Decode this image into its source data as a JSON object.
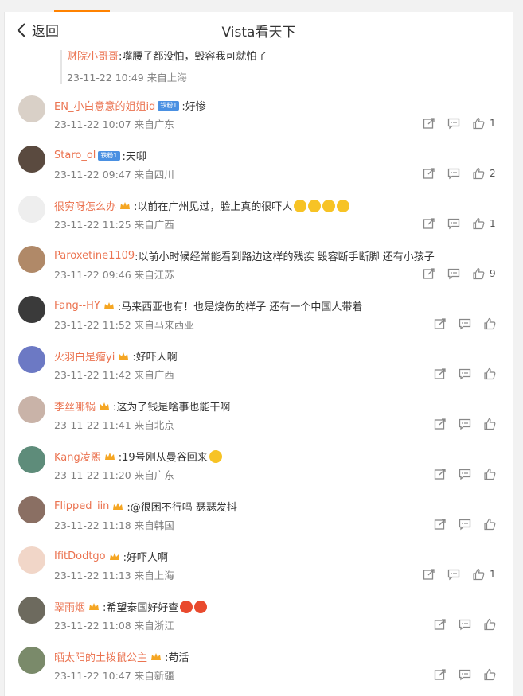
{
  "header": {
    "back_label": "返回",
    "title": "Vista看天下"
  },
  "reply": {
    "user": "财院小哥哥",
    "text": ":嘴腰子都没怕，毁容我可就怕了",
    "time": "23-11-22 10:49",
    "location": "来自上海"
  },
  "comments": [
    {
      "user": "EN_小白意意的姐姐id",
      "badge": "铁粉1",
      "text": ":好惨",
      "time": "23-11-22 10:07",
      "location": "来自广东",
      "likes": "1",
      "avatar_color": "#d9d0c7"
    },
    {
      "user": "Staro_ol",
      "badge": "铁粉1",
      "text": ":天唧",
      "time": "23-11-22 09:47",
      "location": "来自四川",
      "likes": "2",
      "avatar_color": "#5a4a3f"
    },
    {
      "user": "很穷呀怎么办",
      "text": ":以前在广州见过，脸上真的很吓人",
      "time": "23-11-22 11:25",
      "location": "来自广西",
      "likes": "1",
      "avatar_color": "#eeeeee"
    },
    {
      "user": "Paroxetine1109",
      "text": ":以前小时候经常能看到路边这样的残疾 毁容断手断脚 还有小孩子",
      "time": "23-11-22 09:46",
      "location": "来自江苏",
      "likes": "9",
      "avatar_color": "#b08968"
    },
    {
      "user": "Fang--HY",
      "text": ":马来西亚也有！也是烧伤的样子 还有一个中国人带着",
      "time": "23-11-22 11:52",
      "location": "来自马来西亚",
      "likes": "",
      "avatar_color": "#3a3a3a"
    },
    {
      "user": "火羽白是瘤yi",
      "text": ":好吓人啊",
      "time": "23-11-22 11:42",
      "location": "来自广西",
      "likes": "",
      "avatar_color": "#6c79c4"
    },
    {
      "user": "李丝哪锅",
      "text": ":这为了钱是啥事也能干啊",
      "time": "23-11-22 11:41",
      "location": "来自北京",
      "likes": "",
      "avatar_color": "#c9b3a8"
    },
    {
      "user": "Kang凌熙",
      "text": ":19号刚从曼谷回来",
      "time": "23-11-22 11:20",
      "location": "来自广东",
      "likes": "",
      "avatar_color": "#5e8c7a"
    },
    {
      "user": "Flipped_iin",
      "text": ":@很困不行吗 瑟瑟发抖",
      "time": "23-11-22 11:18",
      "location": "来自韩国",
      "likes": "",
      "avatar_color": "#8a6f63"
    },
    {
      "user": "IfitDodtgo",
      "text": ":好吓人啊",
      "time": "23-11-22 11:13",
      "location": "来自上海",
      "likes": "1",
      "avatar_color": "#f1d6c8"
    },
    {
      "user": "翠雨烟",
      "text": ":希望泰国好好查",
      "time": "23-11-22 11:08",
      "location": "来自浙江",
      "likes": "",
      "avatar_color": "#6d6a5e"
    },
    {
      "user": "晒太阳的土拨鼠公主",
      "text": ":苟活",
      "time": "23-11-22 10:47",
      "location": "来自新疆",
      "likes": "",
      "avatar_color": "#7a8a6a"
    }
  ],
  "icons": {
    "share": "share-icon",
    "comment": "comment-icon",
    "like": "like-icon",
    "back": "chevron-left-icon"
  },
  "colors": {
    "accent": "#ff8200",
    "username": "#eb7350",
    "meta": "#808080"
  }
}
